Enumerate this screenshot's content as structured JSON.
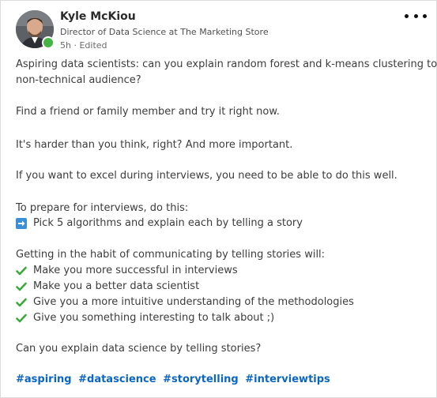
{
  "author": {
    "name": "Kyle McKiou",
    "headline": "Director of Data Science at The Marketing Store",
    "meta": "5h · Edited",
    "presence_color": "#44b444"
  },
  "icons": {
    "more": "ellipsis-icon",
    "check": "heavy-check-mark-icon",
    "arrow": "right-arrow-icon"
  },
  "post": {
    "p1_line1": "Aspiring data scientists: can you explain random forest and k-means clustering to a",
    "p1_line2": "non-technical audience?",
    "p2": "Find a friend or family member and try it right now.",
    "p3": "It's harder than you think, right? And more important.",
    "p4": "If you want to excel during interviews, you need to be able to do this well.",
    "p5": "To prepare for interviews, do this:",
    "arrow_item": "Pick 5 algorithms and explain each by telling a story",
    "p6": "Getting in the habit of communicating by telling stories will:",
    "check_items": [
      "Make you more successful in interviews",
      "Make you a better data scientist",
      "Give you a more intuitive understanding of the methodologies",
      "Give you something interesting to talk about ;)"
    ],
    "p7": "Can you explain data science by telling stories?",
    "hashtags": [
      "#aspiring",
      "#datascience",
      "#storytelling",
      "#interviewtips"
    ]
  },
  "colors": {
    "link": "#0a66c2",
    "check": "#3daa3d",
    "arrow_bg": "#3b8fd6"
  }
}
